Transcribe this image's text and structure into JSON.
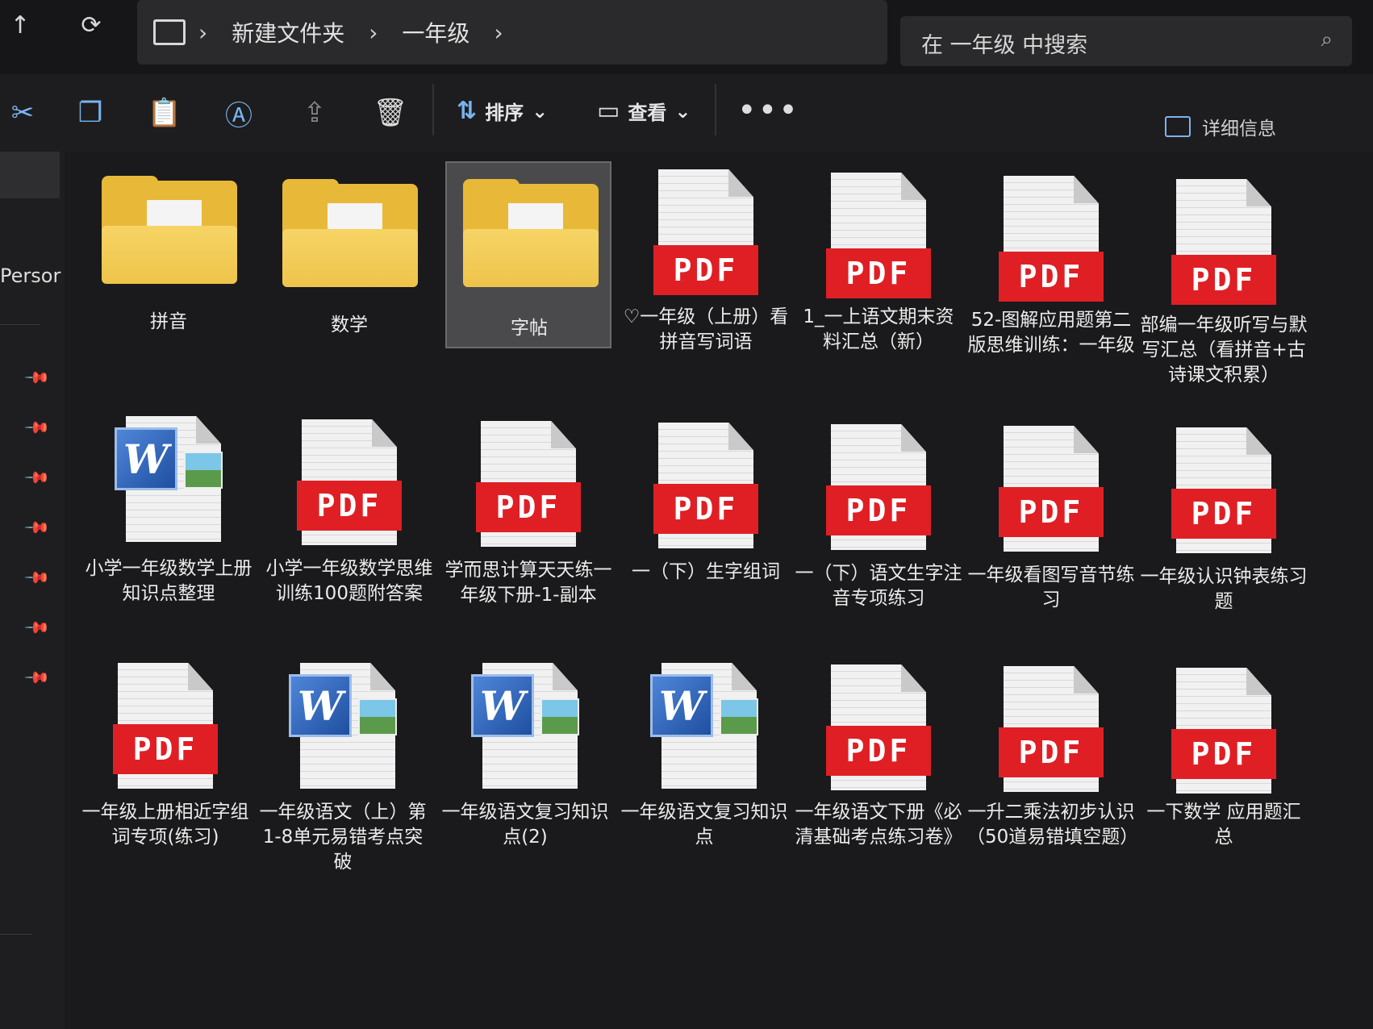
{
  "nav": {
    "up_icon": "↑",
    "refresh_icon": "⟳",
    "pc_icon": "computer-icon"
  },
  "breadcrumb": [
    "新建文件夹",
    "一年级"
  ],
  "search": {
    "placeholder": "在 一年级 中搜索"
  },
  "toolbar": {
    "sort_label": "排序",
    "view_label": "查看",
    "more_label": "•••",
    "details_label": "详细信息"
  },
  "sidebar": {
    "person_label": "Persor"
  },
  "files": [
    {
      "name": "拼音",
      "type": "folder"
    },
    {
      "name": "数学",
      "type": "folder"
    },
    {
      "name": "字帖",
      "type": "folder",
      "selected": true
    },
    {
      "name": "♡一年级（上册）看拼音写词语",
      "type": "pdf"
    },
    {
      "name": "1_一上语文期末资料汇总（新）",
      "type": "pdf"
    },
    {
      "name": "52-图解应用题第二版思维训练：一年级",
      "type": "pdf"
    },
    {
      "name": "部编一年级听写与默写汇总（看拼音+古诗课文积累）",
      "type": "pdf"
    },
    {
      "name": "小学一年级数学上册知识点整理",
      "type": "word"
    },
    {
      "name": "小学一年级数学思维训练100题附答案",
      "type": "pdf"
    },
    {
      "name": "学而思计算天天练一年级下册-1-副本",
      "type": "pdf"
    },
    {
      "name": "一（下）生字组词",
      "type": "pdf"
    },
    {
      "name": "一（下）语文生字注音专项练习",
      "type": "pdf"
    },
    {
      "name": "一年级看图写音节练习",
      "type": "pdf"
    },
    {
      "name": "一年级认识钟表练习题",
      "type": "pdf"
    },
    {
      "name": "一年级上册相近字组词专项(练习)",
      "type": "pdf"
    },
    {
      "name": "一年级语文（上）第1-8单元易错考点突破",
      "type": "word"
    },
    {
      "name": "一年级语文复习知识点(2)",
      "type": "word"
    },
    {
      "name": "一年级语文复习知识点",
      "type": "word"
    },
    {
      "name": "一年级语文下册《必清基础考点练习卷》",
      "type": "pdf"
    },
    {
      "name": "一升二乘法初步认识（50道易错填空题）",
      "type": "pdf"
    },
    {
      "name": "一下数学 应用题汇总",
      "type": "pdf"
    }
  ],
  "pdf_label": "PDF",
  "word_letter": "W"
}
